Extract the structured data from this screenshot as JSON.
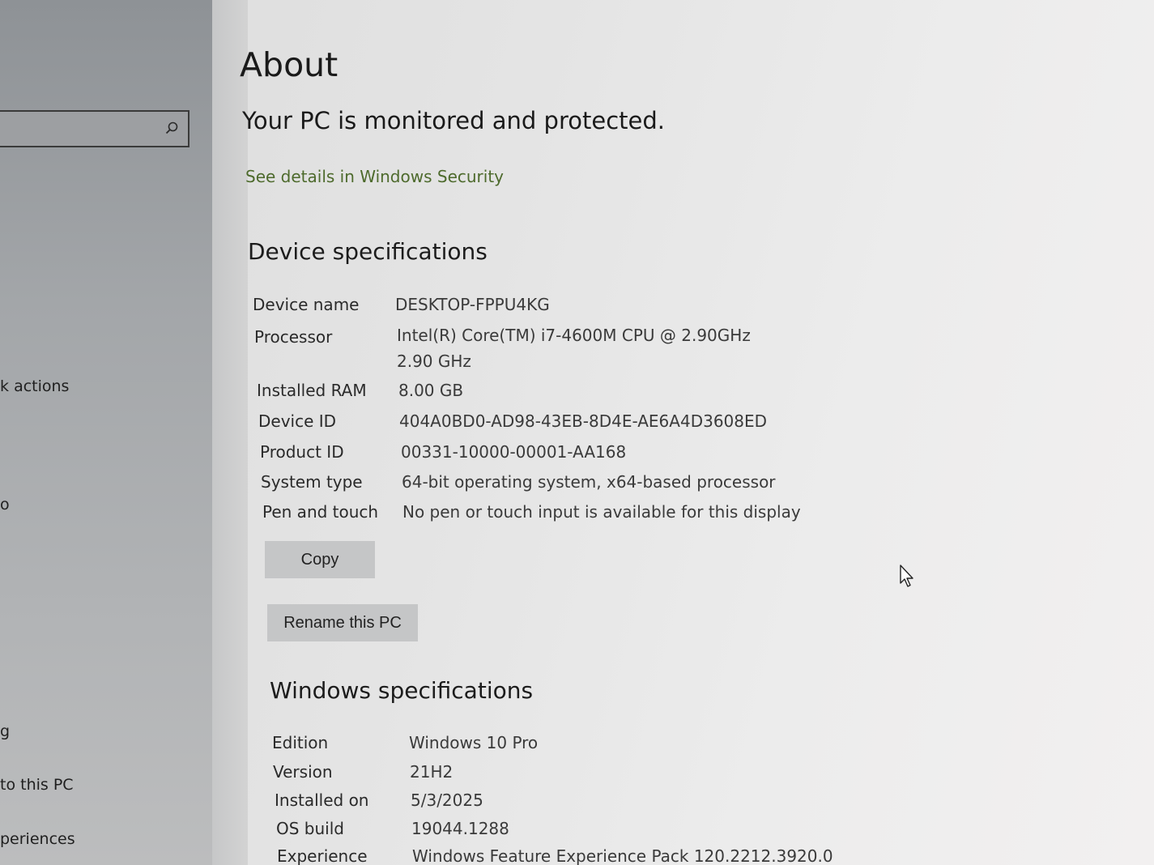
{
  "sidebar": {
    "search_placeholder": "",
    "items": [
      {
        "label": "actions",
        "prefix": "k"
      },
      {
        "label": "",
        "prefix": "o"
      },
      {
        "label": "",
        "prefix": "g"
      },
      {
        "label": "to this PC",
        "prefix": ""
      },
      {
        "label": "periences",
        "prefix": ""
      }
    ]
  },
  "page": {
    "title": "About",
    "protection_heading": "Your PC is monitored and protected.",
    "security_link": "See details in Windows Security"
  },
  "device_specs": {
    "heading": "Device specifications",
    "rows": [
      {
        "label": "Device name",
        "value": "DESKTOP-FPPU4KG"
      },
      {
        "label": "Processor",
        "value": "Intel(R) Core(TM) i7-4600M CPU @ 2.90GHz   2.90 GHz"
      },
      {
        "label": "Installed RAM",
        "value": "8.00 GB"
      },
      {
        "label": "Device ID",
        "value": "404A0BD0-AD98-43EB-8D4E-AE6A4D3608ED"
      },
      {
        "label": "Product ID",
        "value": "00331-10000-00001-AA168"
      },
      {
        "label": "System type",
        "value": "64-bit operating system, x64-based processor"
      },
      {
        "label": "Pen and touch",
        "value": "No pen or touch input is available for this display"
      }
    ],
    "copy_label": "Copy",
    "rename_label": "Rename this PC"
  },
  "windows_specs": {
    "heading": "Windows specifications",
    "rows": [
      {
        "label": "Edition",
        "value": "Windows 10 Pro"
      },
      {
        "label": "Version",
        "value": "21H2"
      },
      {
        "label": "Installed on",
        "value": "5/3/2025"
      },
      {
        "label": "OS build",
        "value": "19044.1288"
      },
      {
        "label": "Experience",
        "value": "Windows Feature Experience Pack 120.2212.3920.0"
      }
    ]
  },
  "colors": {
    "link": "#4d6a2c",
    "sidebar": "#a3a6a9",
    "button": "#c5c6c7"
  },
  "icons": [
    "search-icon",
    "mouse-pointer-icon"
  ]
}
